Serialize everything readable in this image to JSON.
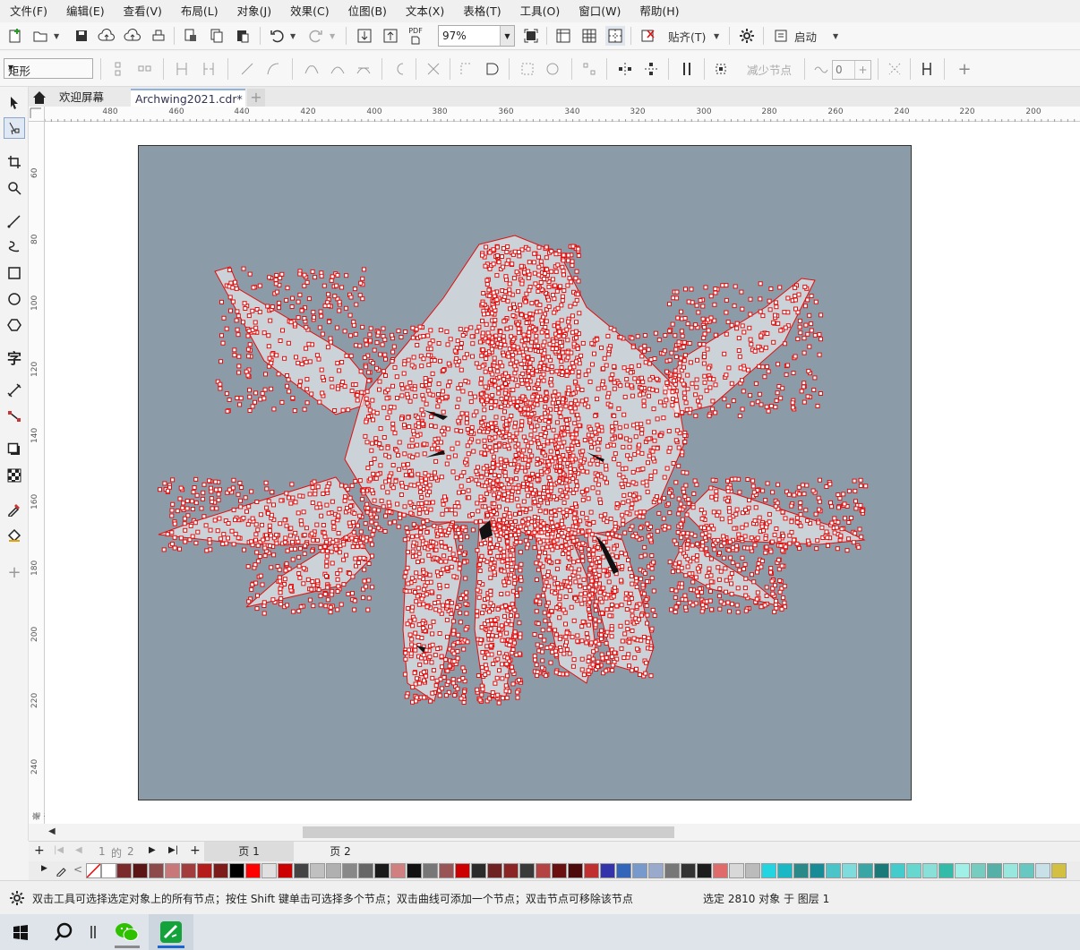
{
  "menu": [
    "文件(F)",
    "编辑(E)",
    "查看(V)",
    "布局(L)",
    "对象(J)",
    "效果(C)",
    "位图(B)",
    "文本(X)",
    "表格(T)",
    "工具(O)",
    "窗口(W)",
    "帮助(H)"
  ],
  "toolbar": {
    "zoom_value": "97%",
    "snap_label": "贴齐(T)",
    "launch_label": "启动",
    "pdf_label": "PDF"
  },
  "property_bar": {
    "shape_select": "矩形",
    "reduce_nodes_label": "减少节点",
    "smoothing_value": "0",
    "add_label": "+"
  },
  "document_tabs": {
    "welcome": "欢迎屏幕",
    "file": "Archwing2021.cdr*",
    "add": "+"
  },
  "ruler": {
    "h_labels": [
      "480",
      "460",
      "440",
      "420",
      "400",
      "380",
      "360",
      "340",
      "320",
      "300",
      "280",
      "260",
      "240",
      "220",
      "200"
    ],
    "v_labels": [
      "60",
      "80",
      "100",
      "120",
      "140",
      "160",
      "180",
      "200",
      "220",
      "240"
    ],
    "unit": "毫米"
  },
  "page_nav": {
    "current": "1",
    "of": "的",
    "total": "2",
    "pages": [
      "页 1",
      "页 2"
    ]
  },
  "palette_colors": [
    "#7a2a2a",
    "#5c1515",
    "#8c4a4a",
    "#c87878",
    "#a33c3c",
    "#b51b1b",
    "#7d1a1a",
    "#000000",
    "#ff0000",
    "#e0e0e0",
    "#cc0000",
    "#444444",
    "#c0c0c0",
    "#b0b0b0",
    "#888888",
    "#666666",
    "#1a1a1a",
    "#d08080",
    "#111111",
    "#777777",
    "#995555",
    "#cc0000",
    "#2b2b2b",
    "#6e2222",
    "#8b2525",
    "#3a3a3a",
    "#b44444",
    "#6a1010",
    "#4d0a0a",
    "#c03030",
    "#3333aa",
    "#3366bb",
    "#7799cc",
    "#99aacc",
    "#777777",
    "#333333",
    "#1c1c1c",
    "#e06b6b",
    "#d8d8d8",
    "#bbbbbb",
    "#22d5e0",
    "#1ab8c5",
    "#2a8a8a",
    "#178c96",
    "#49c4c8",
    "#7fdcdc",
    "#3aa5a5",
    "#1a7a7a",
    "#44cccc",
    "#66d8d0",
    "#88e0d8",
    "#33bbaa",
    "#a0f0e8",
    "#77ccc0",
    "#55b0a8",
    "#99e8e0",
    "#66c8c0",
    "#c8e0e8",
    "#d4c040",
    "#e0d060"
  ],
  "status": {
    "hint": "双击工具可选择选定对象上的所有节点；按住 Shift 键单击可选择多个节点；双击曲线可添加一个节点；双击节点可移除该节点",
    "selection": "选定 2810 对象 于 图层 1"
  },
  "taskbar": {
    "search_icon": "search-icon"
  }
}
